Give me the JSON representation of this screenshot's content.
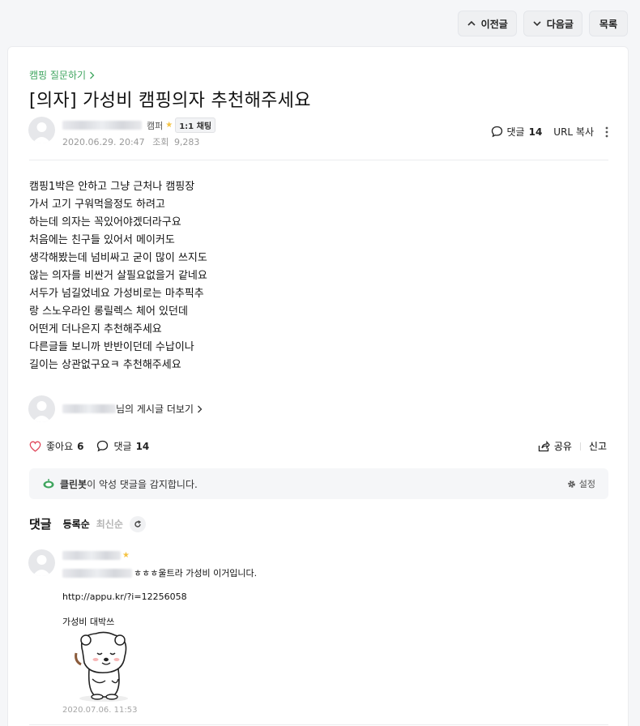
{
  "nav": {
    "prev_label": "이전글",
    "next_label": "다음글",
    "list_label": "목록"
  },
  "article": {
    "board": "캠핑 질문하기",
    "title": "[의자] 가성비 캠핑의자 추천해주세요",
    "author": {
      "grade": "캠퍼",
      "chat_badge": "1:1 채팅"
    },
    "date": "2020.06.29. 20:47",
    "views_label": "조회",
    "views": "9,283",
    "comment_label": "댓글",
    "comment_count": "14",
    "url_copy": "URL 복사",
    "body_lines": [
      "캠핑1박은 안하고 그냥 근처나 캠핑장",
      "가서 고기 구워먹을정도 하려고",
      "하는데 의자는 꼭있어야겠더라구요",
      "처음에는 친구들 있어서 메이커도",
      "생각해봤는데 넘비싸고 굳이 많이 쓰지도",
      "않는 의자를 비싼거 살필요없을거 같네요",
      "서두가 넘길었네요 가성비로는 마추픽추",
      "랑 스노우라인 롱릴렉스 체어 있던데",
      "어떤게 더나은지 추천해주세요",
      "다른글들 보니까 반반이던데 수납이나",
      "길이는 상관없구요ㅋ 추천해주세요"
    ],
    "more_posts_suffix": "님의 게시글 더보기"
  },
  "actions": {
    "like_label": "좋아요",
    "like_count": "6",
    "comment_label": "댓글",
    "comment_count": "14",
    "share_label": "공유",
    "report_label": "신고"
  },
  "cleanbot": {
    "name": "클린봇",
    "message": "이 악성 댓글을 감지합니다.",
    "settings_label": "설정"
  },
  "comments_section": {
    "title": "댓글",
    "sort_register": "등록순",
    "sort_latest": "최신순"
  },
  "comments": [
    {
      "line1": "ㅎㅎㅎ울트라 가성비 이거입니다.",
      "link": "http://appu.kr/?i=12256058",
      "line3": "가성비 대박쓰",
      "date": "2020.07.06. 11:53"
    }
  ],
  "colors": {
    "accent_green": "#3fa55f",
    "star": "#f5c342",
    "like_heart": "#e0475b"
  },
  "icons": {
    "comment": "speech-bubble-icon",
    "heart": "heart-icon",
    "share": "share-icon",
    "gear": "gear-icon",
    "refresh": "refresh-icon",
    "more": "more-vertical-icon",
    "cleanbot": "cleanbot-icon"
  }
}
